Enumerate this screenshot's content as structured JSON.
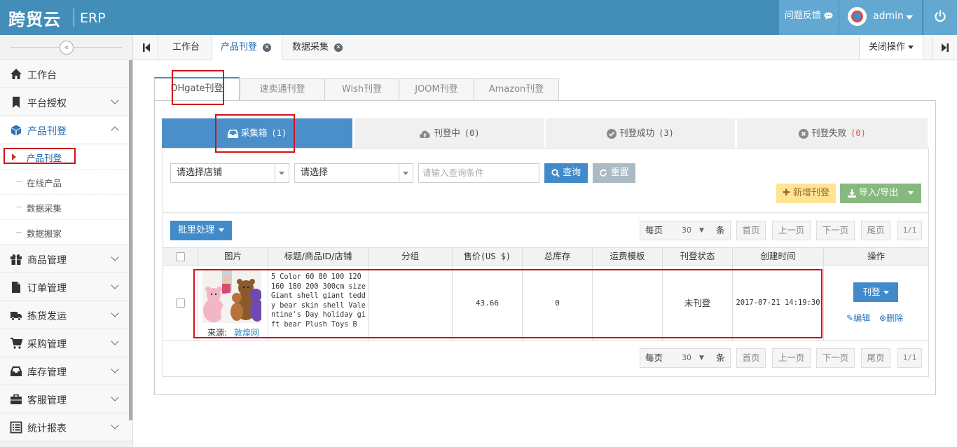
{
  "header": {
    "logo_text": "跨贸云",
    "logo_suffix": "ERP",
    "feedback_label": "问题反馈",
    "username": "admin"
  },
  "sidebar": {
    "items": [
      {
        "label": "工作台",
        "icon": "home-icon"
      },
      {
        "label": "平台授权",
        "icon": "bookmark-icon"
      },
      {
        "label": "产品刊登",
        "icon": "cube-icon"
      },
      {
        "label": "商品管理",
        "icon": "gift-icon"
      },
      {
        "label": "订单管理",
        "icon": "file-icon"
      },
      {
        "label": "拣货发运",
        "icon": "truck-icon"
      },
      {
        "label": "采购管理",
        "icon": "cart-icon"
      },
      {
        "label": "库存管理",
        "icon": "inbox-icon"
      },
      {
        "label": "客服管理",
        "icon": "briefcase-icon"
      },
      {
        "label": "统计报表",
        "icon": "list-icon"
      }
    ],
    "sub_items": [
      "产品刊登",
      "在线产品",
      "数据采集",
      "数据搬家"
    ]
  },
  "page_tabs": [
    {
      "label": "工作台"
    },
    {
      "label": "产品刊登"
    },
    {
      "label": "数据采集"
    }
  ],
  "close_ops_label": "关闭操作",
  "platform_tabs": [
    "DHgate刊登",
    "速卖通刊登",
    "Wish刊登",
    "JOOM刊登",
    "Amazon刊登"
  ],
  "status_tabs": [
    {
      "label": "采集箱",
      "count": "(1)",
      "icon": "inbox-icon"
    },
    {
      "label": "刊登中",
      "count": "(0)",
      "icon": "cloud-upload-icon"
    },
    {
      "label": "刊登成功",
      "count": "(3)",
      "icon": "check-circle-icon"
    },
    {
      "label": "刊登失败",
      "count": "(0)",
      "icon": "times-circle-icon"
    }
  ],
  "filters": {
    "shop_select": "请选择店铺",
    "type_select": "请选择",
    "query_placeholder": "请输入查询条件",
    "search_label": "查询",
    "reset_label": "重置"
  },
  "actions": {
    "add_label": "新增刊登",
    "import_export_label": "导入/导出",
    "batch_label": "批里处理"
  },
  "pagination": {
    "per_page_label": "每页",
    "per_page_value": "30",
    "per_page_unit": "条",
    "first": "首页",
    "prev": "上一页",
    "next": "下一页",
    "last": "尾页",
    "page_info": "1/1"
  },
  "table": {
    "columns": [
      "图片",
      "标题/商品ID/店铺",
      "分组",
      "售价(US $)",
      "总库存",
      "运费模板",
      "刊登状态",
      "创建时间",
      "操作"
    ],
    "rows": [
      {
        "title": "5 Color 60 80 100 120 160 180 200 300cm size Giant shell giant teddy bear skin shell Valentine's Day holiday gift bear Plush Toys B",
        "source_label": "来源:",
        "source_link": "敦煌网",
        "group": "",
        "price": "43.66",
        "stock": "0",
        "shipping_template": "",
        "status": "未刊登",
        "created": "2017-07-21 14:19:30",
        "publish_label": "刊登",
        "edit_label": "编辑",
        "delete_label": "删除"
      }
    ]
  },
  "colors": {
    "header_bg": "#438eb9",
    "accent_blue": "#4b8fca",
    "highlight_red": "#d0111b",
    "failed_red": "#d9534f"
  }
}
